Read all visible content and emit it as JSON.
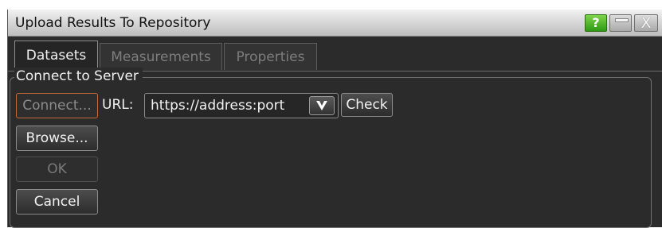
{
  "window": {
    "title": "Upload Results To Repository",
    "help_label": "?",
    "close_label": "X"
  },
  "tabs": [
    {
      "label": "Datasets",
      "active": true
    },
    {
      "label": "Measurements",
      "active": false
    },
    {
      "label": "Properties",
      "active": false
    }
  ],
  "connect_group": {
    "legend": "Connect to Server",
    "connect_label": "Connect...",
    "url_label": "URL:",
    "url_value": "https://address:port",
    "check_label": "Check"
  },
  "actions": {
    "browse_label": "Browse...",
    "ok_label": "OK",
    "cancel_label": "Cancel"
  },
  "icons": {
    "help": "help-icon",
    "minimize": "minimize-icon",
    "close": "close-icon",
    "dropdown": "chevron-down-icon"
  }
}
